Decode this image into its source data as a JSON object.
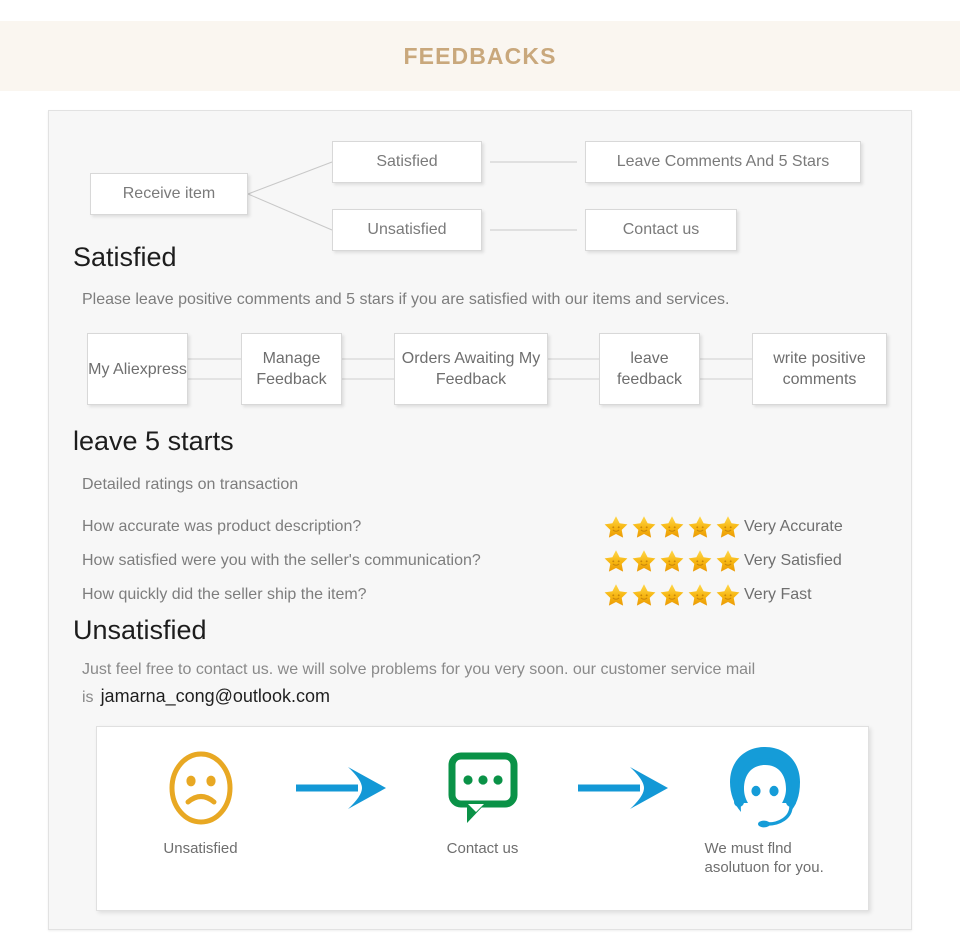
{
  "header": {
    "title": "FEEDBACKS",
    "accent_color": "#c9a87c",
    "band_color": "#faf6f0"
  },
  "flow": {
    "receive": "Receive item",
    "satisfied": "Satisfied",
    "unsatisfied": "Unsatisfied",
    "leave_comments": "Leave Comments And 5 Stars",
    "contact": "Contact us"
  },
  "satisfied_section": {
    "heading": "Satisfied",
    "paragraph": "Please leave positive comments and 5 stars if you are satisfied with our items and services.",
    "steps": [
      "My Aliexpress",
      "Manage Feedback",
      "Orders Awaiting My Feedback",
      "leave feedback",
      "write positive comments"
    ]
  },
  "stars_section": {
    "heading": "leave 5 starts",
    "lead": "Detailed ratings on transaction",
    "star_color": "#f5b013",
    "rows": [
      {
        "question": "How accurate was product description?",
        "stars": 5,
        "answer": "Very Accurate"
      },
      {
        "question": "How satisfied were you with the seller's communication?",
        "stars": 5,
        "answer": "Very Satisfied"
      },
      {
        "question": "How quickly did the seller ship the item?",
        "stars": 5,
        "answer": "Very Fast"
      }
    ]
  },
  "unsatisfied_section": {
    "heading": "Unsatisfied",
    "paragraph": "Just feel free to contact us. we will solve problems for you very soon. our customer service mail is",
    "email": "jamarna_cong@outlook.com"
  },
  "panel": {
    "steps": [
      {
        "label": "Unsatisfied",
        "icon": "sad-face-icon",
        "color": "#e8a823"
      },
      {
        "label": "Contact us",
        "icon": "speech-bubble-icon",
        "color": "#0a9247"
      },
      {
        "label": "We must flnd asolutuon for you.",
        "icon": "support-agent-icon",
        "color": "#159cd8"
      }
    ],
    "arrow_color": "#1398d6"
  }
}
